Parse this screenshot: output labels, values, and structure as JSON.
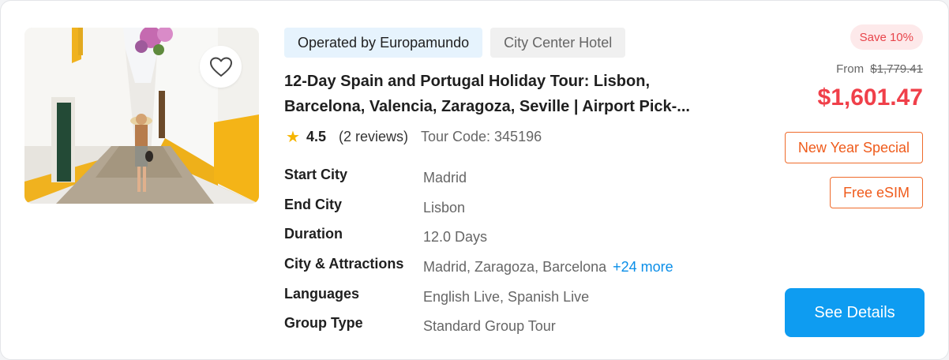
{
  "tags": {
    "operator": "Operated by Europamundo",
    "hotel": "City Center Hotel"
  },
  "title": {
    "line1": "12-Day Spain and Portugal Holiday Tour: Lisbon,",
    "line2": "Barcelona, Valencia, Zaragoza, Seville | Airport Pick-..."
  },
  "rating": {
    "icon": "star-icon",
    "score": "4.5",
    "reviews": "(2 reviews)",
    "tour_code": "Tour Code: 345196"
  },
  "details": [
    {
      "label": "Start City",
      "value": "Madrid"
    },
    {
      "label": "End City",
      "value": "Lisbon"
    },
    {
      "label": "Duration",
      "value": "12.0 Days"
    },
    {
      "label": "City & Attractions",
      "value": "Madrid, Zaragoza, Barcelona",
      "more": "+24 more"
    },
    {
      "label": "Languages",
      "value": "English Live, Spanish Live"
    },
    {
      "label": "Group Type",
      "value": "Standard Group Tour"
    }
  ],
  "pricing": {
    "save_badge": "Save 10%",
    "from_label": "From",
    "original_price": "$1,779.41",
    "price": "$1,601.47"
  },
  "promotions": [
    "New Year Special",
    "Free eSIM"
  ],
  "cta": {
    "label": "See Details"
  },
  "favorite": {
    "icon": "heart-icon"
  },
  "colors": {
    "accent_blue": "#0e9cf1",
    "price_red": "#f0404a",
    "promo_orange": "#ef5b1b",
    "star_yellow": "#f6b500"
  }
}
